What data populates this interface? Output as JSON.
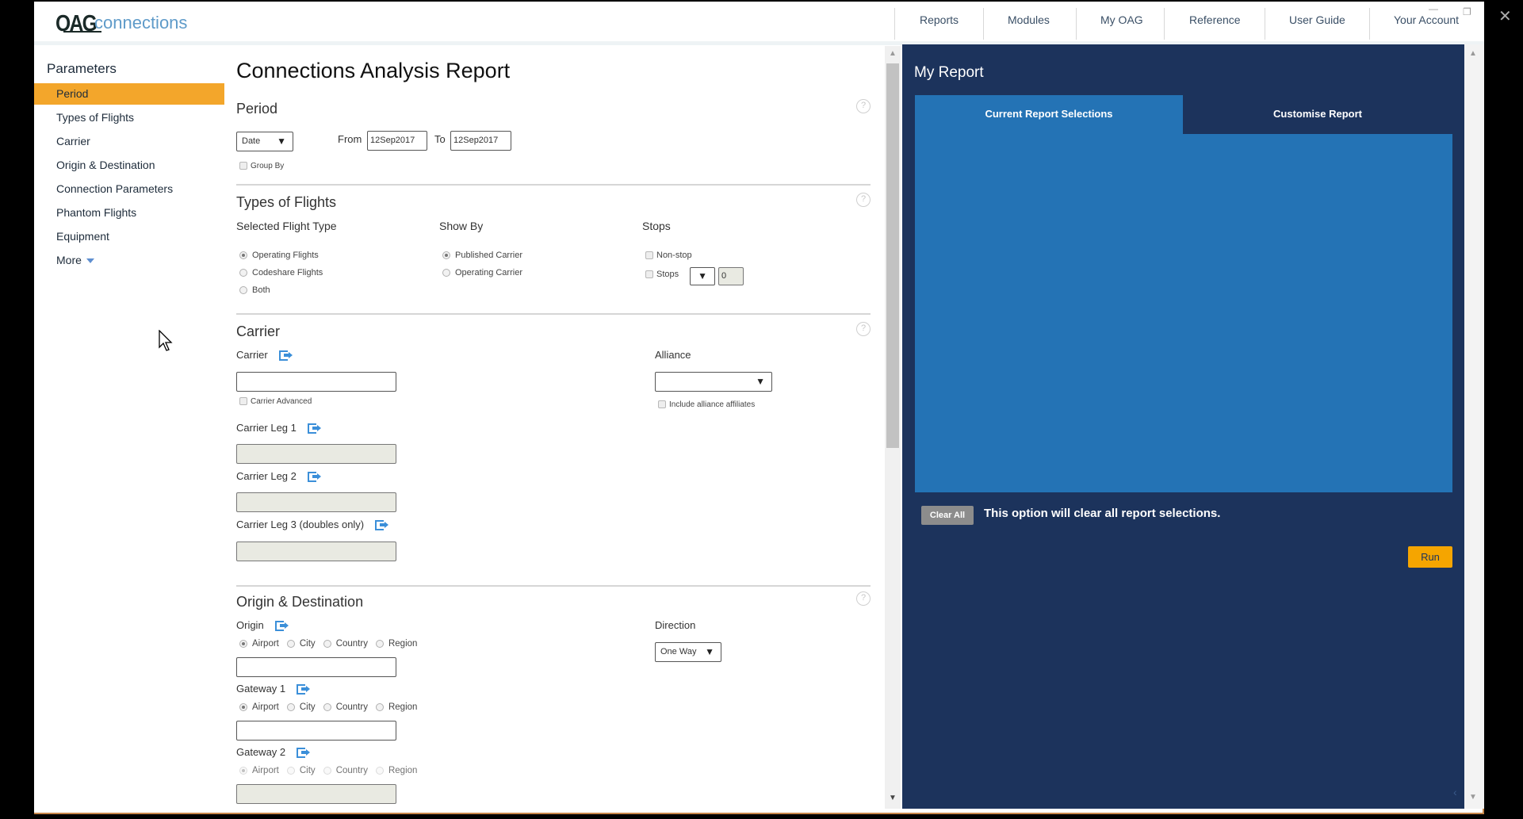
{
  "app": {
    "logo_primary": "OAG",
    "logo_secondary": "connections"
  },
  "nav": {
    "items": [
      "Reports",
      "Modules",
      "My OAG",
      "Reference",
      "User Guide",
      "Your Account"
    ]
  },
  "sidebar": {
    "title": "Parameters",
    "items": [
      {
        "label": "Period",
        "active": true
      },
      {
        "label": "Types of Flights"
      },
      {
        "label": "Carrier"
      },
      {
        "label": "Origin & Destination"
      },
      {
        "label": "Connection Parameters"
      },
      {
        "label": "Phantom Flights"
      },
      {
        "label": "Equipment"
      },
      {
        "label": "More"
      }
    ]
  },
  "main": {
    "title": "Connections Analysis Report",
    "period": {
      "title": "Period",
      "type_select": "Date",
      "from_label": "From",
      "from_value": "12Sep2017",
      "to_label": "To",
      "to_value": "12Sep2017",
      "group_by_label": "Group By"
    },
    "types_of_flights": {
      "title": "Types of Flights",
      "selected_flight_type_label": "Selected Flight Type",
      "flight_types": [
        "Operating Flights",
        "Codeshare Flights",
        "Both"
      ],
      "flight_type_selected": "Operating Flights",
      "show_by_label": "Show By",
      "show_by_options": [
        "Published Carrier",
        "Operating Carrier"
      ],
      "show_by_selected": "Published Carrier",
      "stops_label": "Stops",
      "nonstop_label": "Non-stop",
      "stops_checkbox_label": "Stops",
      "stops_value": "0"
    },
    "carrier": {
      "title": "Carrier",
      "carrier_label": "Carrier",
      "carrier_value": "",
      "carrier_advanced_label": "Carrier Advanced",
      "leg1_label": "Carrier Leg 1",
      "leg2_label": "Carrier Leg 2",
      "leg3_label": "Carrier Leg 3 (doubles only)",
      "alliance_label": "Alliance",
      "alliance_value": "",
      "include_affiliates_label": "Include alliance affiliates"
    },
    "origin_destination": {
      "title": "Origin & Destination",
      "origin_label": "Origin",
      "gateway1_label": "Gateway 1",
      "gateway2_label": "Gateway 2",
      "location_types": [
        "Airport",
        "City",
        "Country",
        "Region"
      ],
      "location_selected": "Airport",
      "direction_label": "Direction",
      "direction_value": "One Way"
    },
    "help_glyph": "?"
  },
  "report_panel": {
    "title": "My Report",
    "tabs": [
      {
        "label": "Current Report Selections",
        "active": true
      },
      {
        "label": "Customise Report",
        "active": false
      }
    ],
    "clear_all_label": "Clear All",
    "clear_all_text": "This option will clear all report selections.",
    "run_label": "Run"
  },
  "colors": {
    "accent_orange": "#f3a62b",
    "panel_navy": "#1c335c",
    "panel_blue": "#2473b5",
    "link_blue": "#3b8fd9",
    "run_button": "#f5a500"
  }
}
